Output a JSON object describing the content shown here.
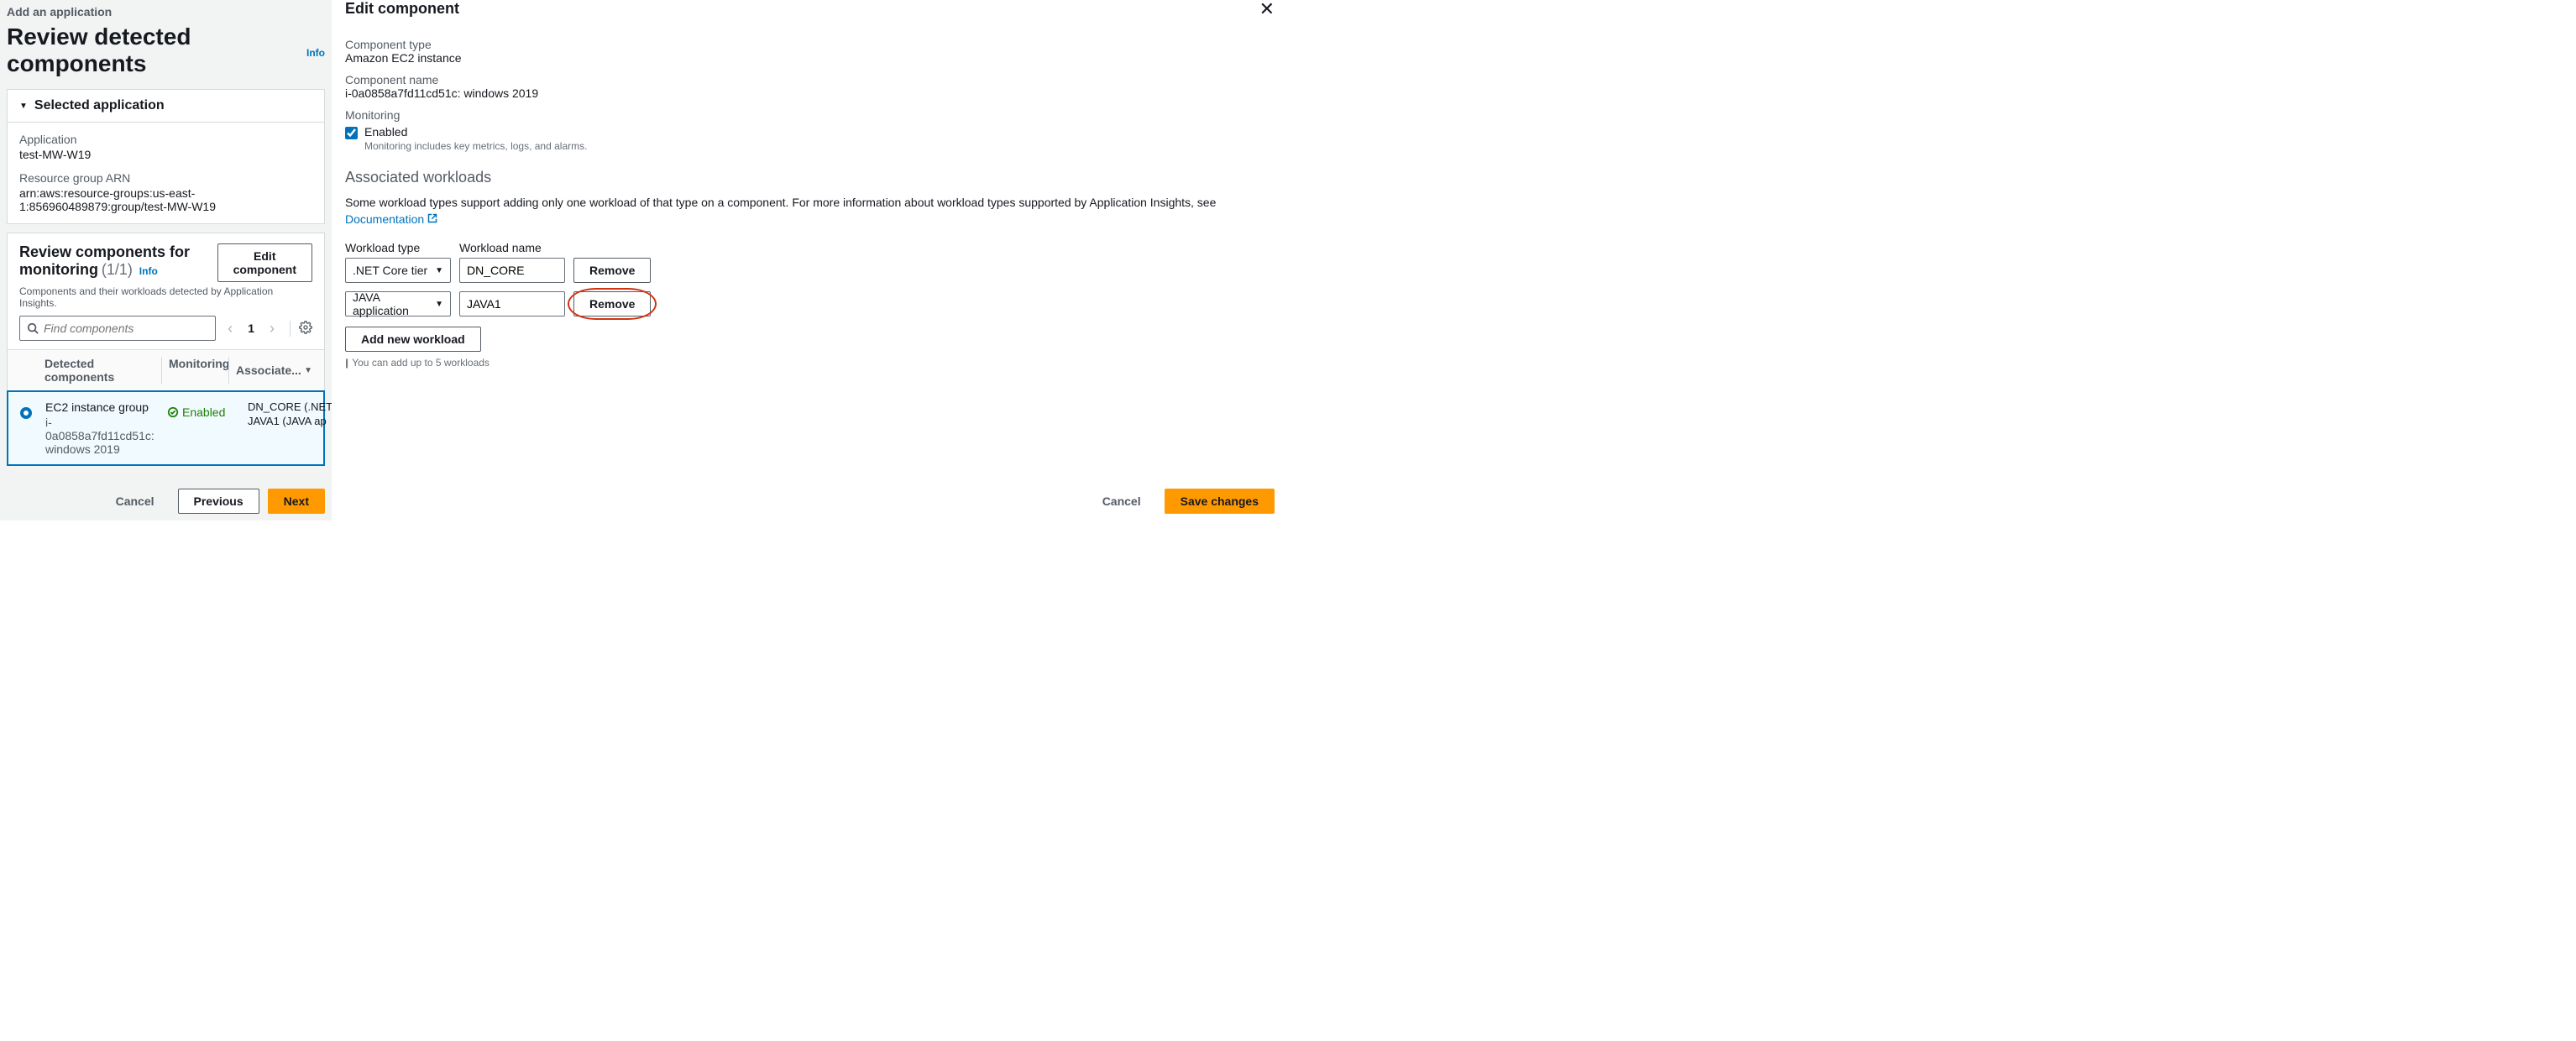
{
  "breadcrumb": "Add an application",
  "page": {
    "title": "Review detected components",
    "info": "Info"
  },
  "selected_app_panel": {
    "title": "Selected application",
    "application_label": "Application",
    "application_value": "test-MW-W19",
    "arn_label": "Resource group ARN",
    "arn_value": "arn:aws:resource-groups:us-east-1:856960489879:group/test-MW-W19"
  },
  "review_panel": {
    "title": "Review components for monitoring",
    "count": "(1/1)",
    "info": "Info",
    "subtitle": "Components and their workloads detected by Application Insights.",
    "edit_btn": "Edit component",
    "search_placeholder": "Find components",
    "page_num": "1",
    "columns": {
      "detected": "Detected components",
      "monitoring": "Monitoring",
      "associated": "Associate..."
    },
    "row": {
      "name": "EC2 instance group",
      "sub": "i-0a0858a7fd11cd51c: windows 2019",
      "monitoring": "Enabled",
      "assoc": [
        "DN_CORE (.NET",
        "JAVA1 (JAVA ap"
      ]
    }
  },
  "footer": {
    "cancel": "Cancel",
    "previous": "Previous",
    "next": "Next"
  },
  "edit_panel": {
    "title": "Edit component",
    "component_type_label": "Component type",
    "component_type_value": "Amazon EC2 instance",
    "component_name_label": "Component name",
    "component_name_value": "i-0a0858a7fd11cd51c: windows 2019",
    "monitoring_label": "Monitoring",
    "enabled_label": "Enabled",
    "enabled_hint": "Monitoring includes key metrics, logs, and alarms.",
    "assoc_title": "Associated workloads",
    "desc": "Some workload types support adding only one workload of that type on a component. For more information about workload types supported by Application Insights, see ",
    "doc_link": "Documentation",
    "col_type": "Workload type",
    "col_name": "Workload name",
    "workloads": [
      {
        "type": ".NET Core tier",
        "name": "DN_CORE",
        "remove": "Remove",
        "highlight": false
      },
      {
        "type": "JAVA application",
        "name": "JAVA1",
        "remove": "Remove",
        "highlight": true
      }
    ],
    "add_btn": "Add new workload",
    "hint": "You can add up to 5 workloads",
    "cancel": "Cancel",
    "save": "Save changes"
  }
}
